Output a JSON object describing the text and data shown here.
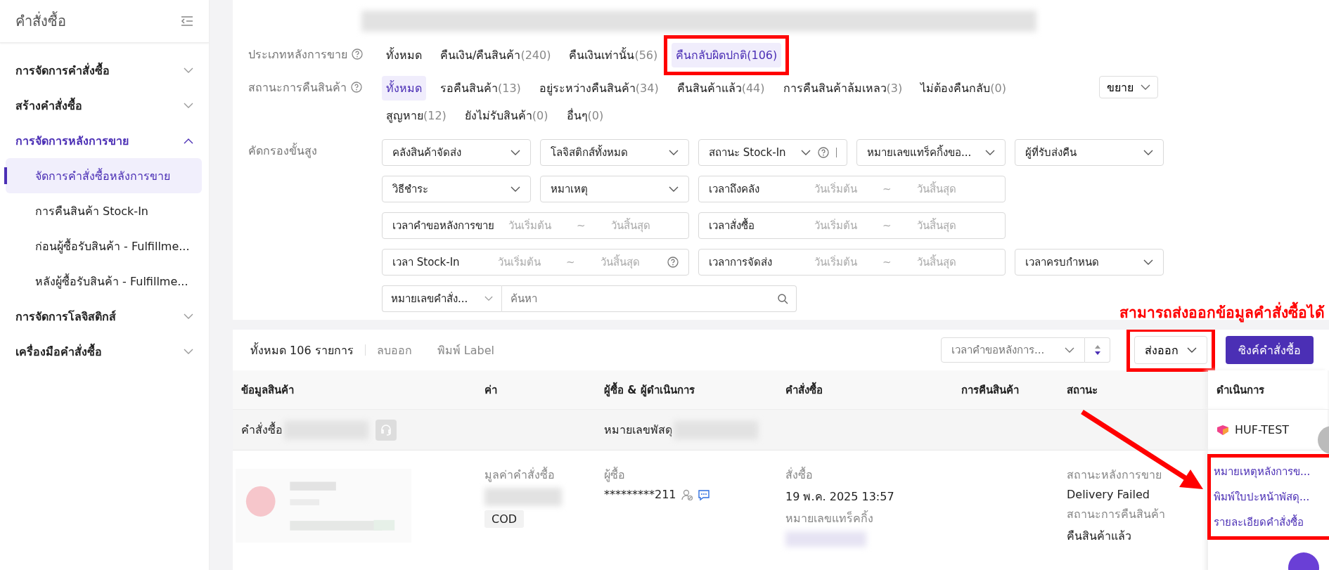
{
  "sidebar": {
    "title": "คำสั่งซื้อ",
    "groups": [
      {
        "label": "การจัดการคำสั่งซื้อ",
        "expanded": false
      },
      {
        "label": "สร้างคำสั่งซื้อ",
        "expanded": false
      },
      {
        "label": "การจัดการหลังการขาย",
        "expanded": true,
        "children": [
          {
            "label": "จัดการคำสั่งซื้อหลังการขาย",
            "selected": true
          },
          {
            "label": "การคืนสินค้า Stock-In",
            "selected": false
          },
          {
            "label": "ก่อนผู้ซื้อรับสินค้า - Fulfillme...",
            "selected": false
          },
          {
            "label": "หลังผู้ซื้อรับสินค้า - Fulfillme...",
            "selected": false
          }
        ]
      },
      {
        "label": "การจัดการโลจิสติกส์",
        "expanded": false
      },
      {
        "label": "เครื่องมือคำสั่งซื้อ",
        "expanded": false
      }
    ]
  },
  "filters": {
    "rows": [
      {
        "label": "ประเภทหลังการขาย",
        "options": [
          {
            "text": "ทั้งหมด",
            "selected": false
          },
          {
            "text": "คืนเงิน/คืนสินค้า",
            "count": "(240)",
            "selected": false
          },
          {
            "text": "คืนเงินเท่านั้น",
            "count": "(56)",
            "selected": false
          },
          {
            "text": "คืนกลับผิดปกติ",
            "count": "(106)",
            "selected": true,
            "highlighted": true
          }
        ]
      },
      {
        "label": "สถานะการคืนสินค้า",
        "expand_button": "ขยาย",
        "options": [
          {
            "text": "ทั้งหมด",
            "selected": true
          },
          {
            "text": "รอคืนสินค้า",
            "count": "(13)",
            "selected": false
          },
          {
            "text": "อยู่ระหว่างคืนสินค้า",
            "count": "(34)",
            "selected": false
          },
          {
            "text": "คืนสินค้าแล้ว",
            "count": "(44)",
            "selected": false
          },
          {
            "text": "การคืนสินค้าล้มเหลว",
            "count": "(3)",
            "selected": false
          },
          {
            "text": "ไม่ต้องคืนกลับ",
            "count": "(0)",
            "selected": false
          },
          {
            "text": "สูญหาย",
            "count": "(12)",
            "selected": false
          },
          {
            "text": "ยังไม่รับสินค้า",
            "count": "(0)",
            "selected": false
          },
          {
            "text": "อื่นๆ",
            "count": "(0)",
            "selected": false
          }
        ]
      }
    ],
    "advanced": {
      "label": "คัดกรองขั้นสูง",
      "fields": [
        {
          "kind": "select",
          "label": "คลังสินค้าจัดส่ง",
          "help": false
        },
        {
          "kind": "select",
          "label": "โลจิสติกส์ทั้งหมด",
          "help": false
        },
        {
          "kind": "select",
          "label": "สถานะ Stock-In",
          "help": true
        },
        {
          "kind": "select",
          "label": "หมายเลขแทร็คกิ้งขอ...",
          "help": false
        },
        {
          "kind": "select",
          "label": "ผู้ที่รับส่งคืน",
          "help": false
        },
        {
          "kind": "select",
          "label": "วิธีชำระ",
          "help": false
        },
        {
          "kind": "select",
          "label": "หมาเหตุ",
          "help": false
        },
        {
          "kind": "range",
          "label": "เวลาถึงคลัง",
          "start": "วันเริ่มต้น",
          "separator": "~",
          "end": "วันสิ้นสุด",
          "help": false
        },
        {
          "kind": "range",
          "label": "เวลาคำขอหลังการขาย",
          "start": "วันเริ่มต้น",
          "separator": "~",
          "end": "วันสิ้นสุด",
          "help": false
        },
        {
          "kind": "range",
          "label": "เวลาสั่งซื้อ",
          "start": "วันเริ่มต้น",
          "separator": "~",
          "end": "วันสิ้นสุด",
          "help": false
        },
        {
          "kind": "range",
          "label": "เวลา Stock-In",
          "start": "วันเริ่มต้น",
          "separator": "~",
          "end": "วันสิ้นสุด",
          "help": true
        },
        {
          "kind": "range",
          "label": "เวลาการจัดส่ง",
          "start": "วันเริ่มต้น",
          "separator": "~",
          "end": "วันสิ้นสุด",
          "help": false
        },
        {
          "kind": "select",
          "label": "เวลาครบกำหนด",
          "help": false
        },
        {
          "kind": "search",
          "label": "หมายเลขคำสั่ง...",
          "placeholder": "ค้นหา"
        }
      ]
    }
  },
  "annotation": "สามารถส่งออกข้อมูลคำสั่งซื้อได้",
  "toolbar": {
    "total": "ทั้งหมด 106 รายการ",
    "actions": [
      "ลบออก",
      "พิมพ์ Label"
    ],
    "sort": "เวลาคำขอหลังการ...",
    "export": {
      "label": "ส่งออก",
      "highlighted": true
    },
    "sync": "ซิงค์คำสั่งซื้อ"
  },
  "table": {
    "columns": [
      "ข้อมูลสินค้า",
      "ค่า",
      "ผู้ซื้อ & ผู้ดำเนินการ",
      "คำสั่งซื้อ",
      "การคืนสินค้า",
      "สถานะ",
      "ดำเนินการ"
    ],
    "order": {
      "order_label": "คำสั่งซื้อ",
      "parcel_label": "หมายเลขพัสดุ",
      "shop": "HUF-TEST"
    },
    "row": {
      "value_label": "มูลค่าคำสั่งซื้อ",
      "payment": "COD",
      "buyer_label": "ผู้ซื้อ",
      "buyer": "*********211",
      "ordered_label": "สั่งซื้อ",
      "ordered": "19 พ.ค. 2025 13:57",
      "tracking_label": "หมายเลขแทร็คกิ้ง",
      "after_sale_label": "สถานะหลังการขาย",
      "after_sale": "Delivery Failed",
      "return_label": "สถานะการคืนสินค้า",
      "return": "คืนสินค้าแล้ว",
      "actions_highlighted": true,
      "actions": [
        "หมายเหตุหลังการข...",
        "พิมพ์ใบปะหน้าพัสดุ...",
        "รายละเอียดคำสั่งซื้อ"
      ]
    }
  }
}
